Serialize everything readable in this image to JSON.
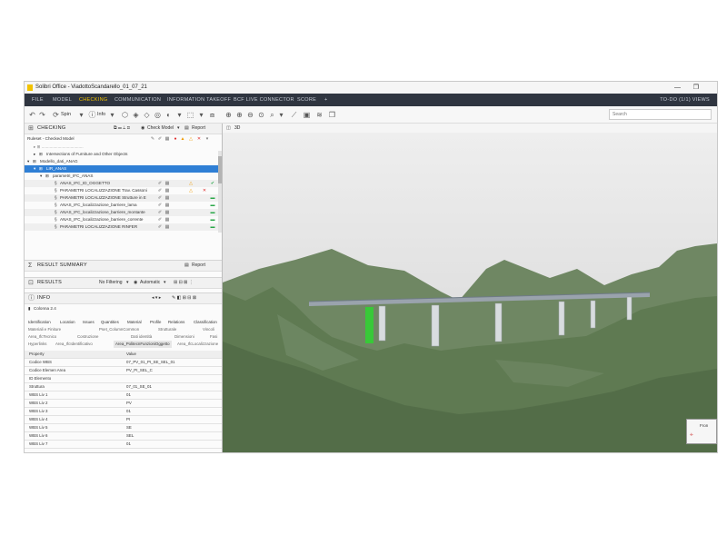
{
  "window": {
    "title": "Solibri Office - ViadottoScandarello_01_07_21",
    "minimize": "—",
    "restore": "❐"
  },
  "menu": {
    "items": [
      "FILE",
      "MODEL",
      "CHECKING",
      "COMMUNICATION",
      "INFORMATION TAKEOFF",
      "BCF LIVE CONNECTOR",
      "SCORE",
      "+"
    ],
    "right": "TO-DO (1/1)   VIEWS"
  },
  "toolbar": {
    "spin_label": "Spin",
    "info_label": "Info",
    "search_placeholder": "Search"
  },
  "checking": {
    "title": "CHECKING",
    "check_model": "Check Model",
    "report": "Report",
    "ruleset_header": "Ruleset - Checked Model",
    "rows": [
      {
        "label": "Intersections of Furniture and Other Objects",
        "indent": 1,
        "status": ""
      },
      {
        "label": "Modello_dati_ANAG",
        "indent": 0,
        "status": ""
      },
      {
        "label": "LIR_ANAS",
        "indent": 1,
        "status": "",
        "selected": true
      },
      {
        "label": "parametri_IFC_ANAS",
        "indent": 2,
        "status": ""
      },
      {
        "label": "ANAS_IFC_ID_OGGETTO",
        "indent": 3,
        "status": "ok"
      },
      {
        "label": "PARAMETRI LOCALIZZAZIONE Trav. Cassoni",
        "indent": 3,
        "status": "err"
      },
      {
        "label": "PARAMETRI LOCALIZZAZIONE Strutture in E",
        "indent": 3,
        "status": "ok"
      },
      {
        "label": "ANAS_IFC_localizzazione_barriere_lama",
        "indent": 3,
        "status": "ok"
      },
      {
        "label": "ANAS_IFC_localizzazione_barriere_montante",
        "indent": 3,
        "status": "ok"
      },
      {
        "label": "ANAS_IFC_localizzazione_barriere_corrente",
        "indent": 3,
        "status": "ok"
      },
      {
        "label": "PARAMETRI LOCALIZZAZIONE RINFER",
        "indent": 3,
        "status": "ok"
      }
    ]
  },
  "result_summary": {
    "title": "RESULT SUMMARY",
    "report": "Report"
  },
  "results": {
    "title": "RESULTS",
    "filter": "No Filtering",
    "mode": "Automatic"
  },
  "info": {
    "title": "INFO",
    "subject": "Colonna 2.4",
    "tabs_row1": [
      "Identification",
      "Location",
      "Issues",
      "Quantities",
      "Material",
      "Profile",
      "Relations",
      "Classification"
    ],
    "tabs_row2": [
      "Materiali e Finiture",
      "Pset_ColumnCommon",
      "Strutturale",
      "Vincoli"
    ],
    "tabs_row3": [
      "Area_IfcTecnico",
      "Costruzione",
      "Dati identità",
      "Dimensioni",
      "Fasi"
    ],
    "tabs_row4": [
      "Hyperlinks",
      "Area_IfcIdentificativo",
      "Area_PolitecnFunzioniOggetto",
      "Area_IfcLocalizzazione"
    ],
    "table_header": {
      "property": "Property",
      "value": "Value"
    },
    "properties": [
      {
        "k": "Codice WBS",
        "v": "07_PV_01_PI_SE_SEL_01"
      },
      {
        "k": "Codice Elemen Area",
        "v": "PV_PI_SEL_C"
      },
      {
        "k": "ID Elemento",
        "v": ""
      },
      {
        "k": "Struttura",
        "v": "07_01_SE_01"
      },
      {
        "k": "WBS Liv 1",
        "v": "01"
      },
      {
        "k": "WBS Liv 2",
        "v": "PV"
      },
      {
        "k": "WBS Liv 3",
        "v": "01"
      },
      {
        "k": "WBS Liv 4",
        "v": "PI"
      },
      {
        "k": "WBS Liv 5",
        "v": "SE"
      },
      {
        "k": "WBS Liv 6",
        "v": "SEL"
      },
      {
        "k": "WBS Liv 7",
        "v": "01"
      }
    ]
  },
  "viewport": {
    "title": "3D",
    "navcube_label": "Fron"
  },
  "colors": {
    "menubar": "#2f3540",
    "accent": "#f2c200",
    "selection": "#2f7fd5",
    "sky": "#dcdcdc",
    "terrain": "#5f7a52",
    "highlight_pier": "#38c938"
  }
}
